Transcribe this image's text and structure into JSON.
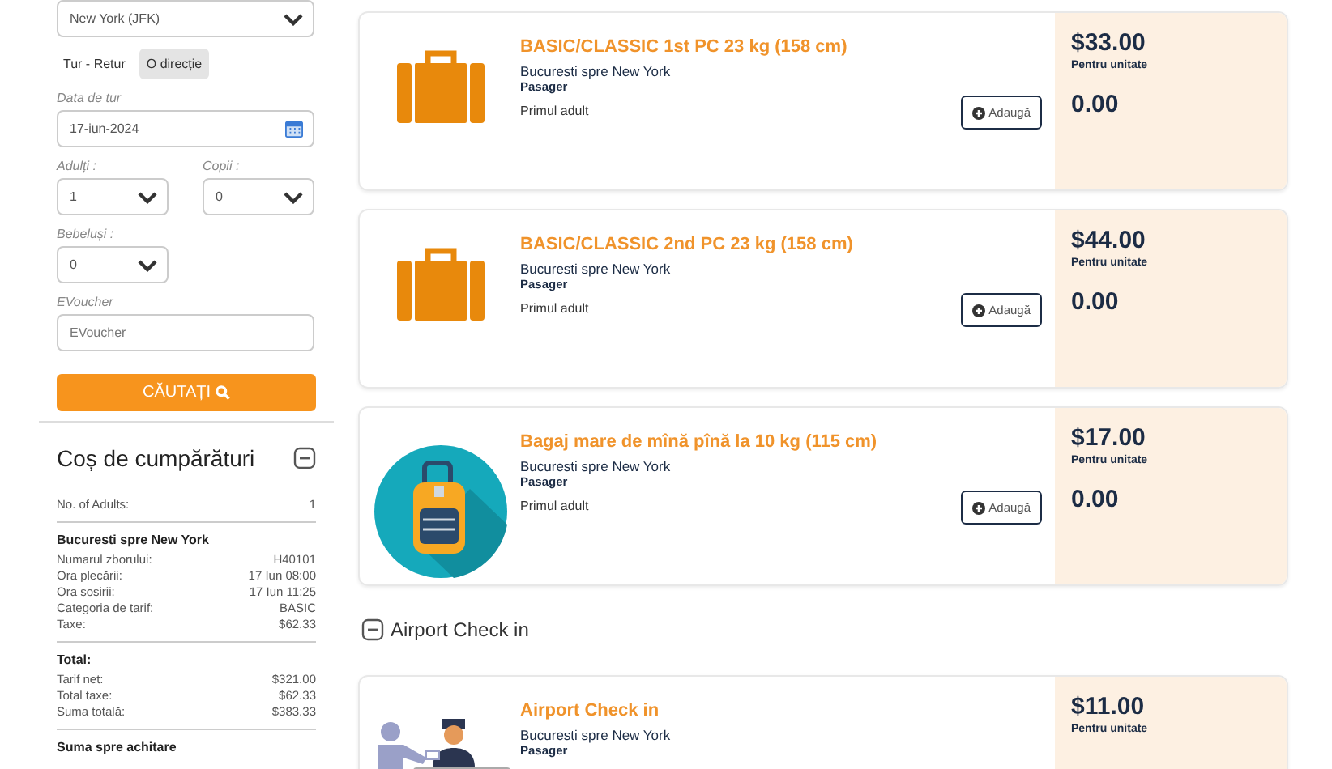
{
  "search_form": {
    "destination": {
      "value": "New York (JFK)"
    },
    "trip_types": [
      {
        "label": "Tur - Retur",
        "selected": false
      },
      {
        "label": "O direcție",
        "selected": true
      }
    ],
    "date": {
      "label": "Data de tur",
      "value": "17-iun-2024"
    },
    "adults": {
      "label": "Adulți :",
      "value": "1"
    },
    "children": {
      "label": "Copii :",
      "value": "0"
    },
    "infants": {
      "label": "Bebeluși :",
      "value": "0"
    },
    "evoucher": {
      "label": "EVoucher",
      "placeholder": "EVoucher"
    },
    "search_button": "CĂUTAȚI"
  },
  "cart": {
    "title": "Coș de cumpărături",
    "expanded": true,
    "adults": {
      "label": "No. of Adults:",
      "value": "1"
    },
    "flight": {
      "title": "Bucuresti spre New York",
      "rows": [
        {
          "label": "Numarul zborului:",
          "value": "H40101"
        },
        {
          "label": "Ora plecării:",
          "value": "17 Iun 08:00"
        },
        {
          "label": "Ora sosirii:",
          "value": "17 Iun 11:25"
        },
        {
          "label": "Categoria de tarif:",
          "value": "BASIC"
        },
        {
          "label": "Taxe:",
          "value": "$62.33"
        }
      ]
    },
    "total": {
      "title": "Total:",
      "rows": [
        {
          "label": "Tarif net:",
          "value": "$321.00"
        },
        {
          "label": "Total taxe:",
          "value": "$62.33"
        },
        {
          "label": "Suma totală:",
          "value": "$383.33"
        }
      ]
    },
    "payable_label": "Suma spre achitare"
  },
  "products": [
    {
      "kind": "suitcase",
      "title": "BASIC/CLASSIC 1st PC 23 kg (158 cm)",
      "route": "Bucuresti spre New York",
      "passenger_label": "Pasager",
      "passenger": "Primul adult",
      "button": "Adaugă",
      "price": "$33.00",
      "unit": "Pentru unitate",
      "amount": "0.00"
    },
    {
      "kind": "suitcase",
      "title": "BASIC/CLASSIC 2nd PC 23 kg (158 cm)",
      "route": "Bucuresti spre New York",
      "passenger_label": "Pasager",
      "passenger": "Primul adult",
      "button": "Adaugă",
      "price": "$44.00",
      "unit": "Pentru unitate",
      "amount": "0.00"
    },
    {
      "kind": "trolley",
      "title": "Bagaj mare de mînă pînă la 10 kg (115 cm)",
      "route": "Bucuresti spre New York",
      "passenger_label": "Pasager",
      "passenger": "Primul adult",
      "button": "Adaugă",
      "price": "$17.00",
      "unit": "Pentru unitate",
      "amount": "0.00"
    }
  ],
  "checkin_section": {
    "title": "Airport Check in",
    "expanded": true,
    "products": [
      {
        "kind": "checkin",
        "title": "Airport Check in",
        "route": "Bucuresti spre New York",
        "passenger_label": "Pasager",
        "price": "$11.00",
        "unit": "Pentru unitate"
      }
    ]
  }
}
